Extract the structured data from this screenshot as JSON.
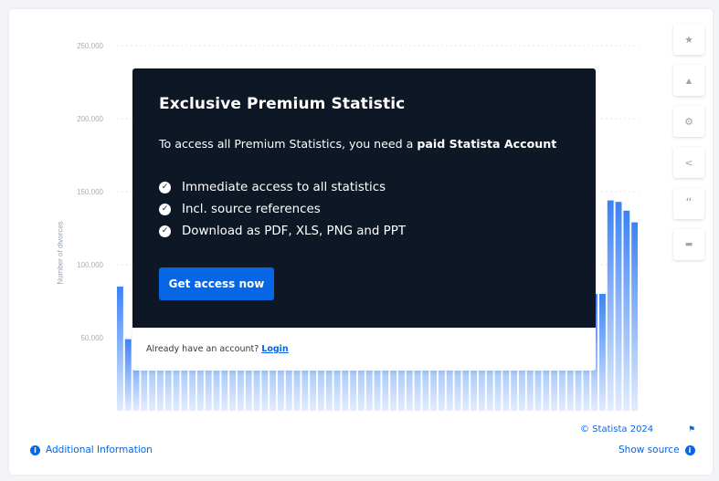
{
  "chart_data": {
    "type": "bar",
    "ylabel": "Number of divorces",
    "ylim": [
      0,
      250000
    ],
    "yticks": [
      "250,000",
      "200,000",
      "150,000",
      "100,000",
      "50,000"
    ],
    "grid": true,
    "bar_color": "#3b82f6",
    "visible_values": [
      85000,
      49000,
      51000,
      80000,
      80000,
      80000,
      80000,
      80000,
      80000,
      80000,
      80000,
      80000,
      80000,
      80000,
      80000,
      80000,
      80000,
      80000,
      80000,
      80000,
      80000,
      80000,
      80000,
      80000,
      80000,
      80000,
      80000,
      80000,
      80000,
      80000,
      80000,
      80000,
      80000,
      80000,
      80000,
      80000,
      80000,
      80000,
      80000,
      80000,
      80000,
      80000,
      80000,
      80000,
      80000,
      80000,
      80000,
      80000,
      80000,
      80000,
      80000,
      80000,
      80000,
      80000,
      80000,
      80000,
      80000,
      80000,
      80000,
      80000,
      80000,
      144000,
      143000,
      137000,
      129000
    ]
  },
  "paywall": {
    "title": "Exclusive Premium Statistic",
    "intro_prefix": "To access all Premium Statistics, you need a ",
    "intro_bold": "paid Statista Account",
    "benefits": [
      "Immediate access to all statistics",
      "Incl. source references",
      "Download as PDF, XLS, PNG and PPT"
    ],
    "cta_label": "Get access now",
    "login_prompt": "Already have an account? ",
    "login_label": "Login"
  },
  "sidebar_tools": [
    {
      "icon": "star-icon",
      "glyph": "★",
      "name": "favorite-button"
    },
    {
      "icon": "bell-icon",
      "glyph": "▲",
      "name": "notification-button"
    },
    {
      "icon": "gear-icon",
      "glyph": "⚙",
      "name": "settings-button"
    },
    {
      "icon": "share-icon",
      "glyph": "<",
      "name": "share-button"
    },
    {
      "icon": "quote-icon",
      "glyph": "“",
      "name": "cite-button"
    },
    {
      "icon": "print-icon",
      "glyph": "▬",
      "name": "print-button"
    }
  ],
  "footer": {
    "copyright": "© Statista 2024",
    "additional_info": "Additional Information",
    "show_source": "Show source",
    "info_glyph": "i"
  },
  "colors": {
    "accent": "#0666e5",
    "overlay_bg": "#0e1726",
    "bar": "#3b82f6"
  }
}
